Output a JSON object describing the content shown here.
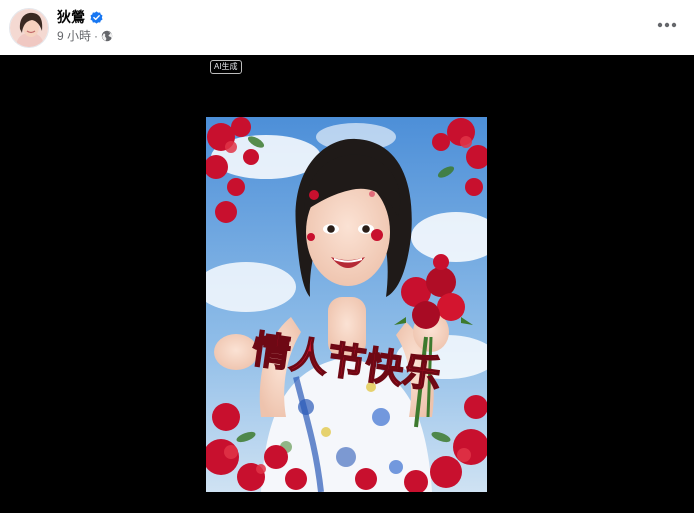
{
  "author": {
    "name": "狄鶯",
    "verified": true
  },
  "post_meta": {
    "time": "9 小時",
    "separator": "·",
    "audience_icon": "globe-icon"
  },
  "more_menu_icon": "more-horizontal-icon",
  "media": {
    "ai_badge": "AI生成",
    "image_caption_text": "情人节快乐"
  },
  "colors": {
    "verified_blue": "#1877f2",
    "meta_gray": "#65676b",
    "media_background": "#000000",
    "sky_blue": "#5a9fe0",
    "flower_red": "#c8102e"
  }
}
